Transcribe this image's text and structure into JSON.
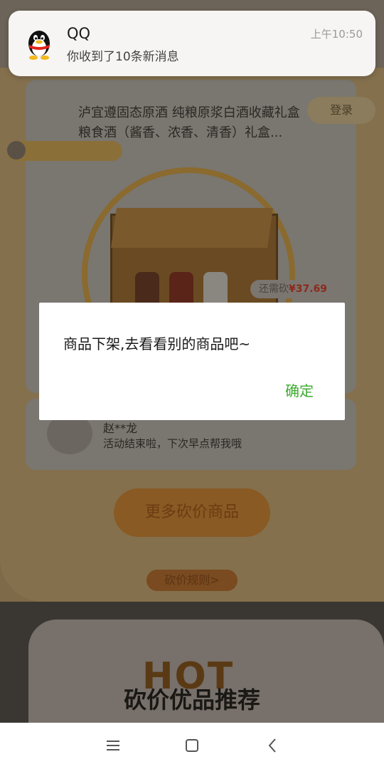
{
  "notification": {
    "app": "QQ",
    "time": "上午10:50",
    "message": "你收到了10条新消息"
  },
  "product": {
    "title": "泸宜遵固态原酒 纯粮原浆白酒收藏礼盒 粮食酒（酱香、浓香、清香）礼盒...",
    "login_label": "登录",
    "remain_label": "还需砍",
    "remain_price": "¥37.69"
  },
  "helper": {
    "name": "赵**龙",
    "message": "活动结束啦，下次早点帮我哦"
  },
  "more_button": "更多砍价商品",
  "rules_button": "砍价规则>",
  "recommend": {
    "hot": "HOT",
    "title": "砍价优品推荐"
  },
  "dialog": {
    "message": "商品下架,去看看别的商品吧~",
    "confirm": "确定"
  },
  "colors": {
    "confirm": "#3cab2e"
  },
  "icons": {
    "qq": "qq-penguin-icon",
    "nav_menu": "menu-icon",
    "nav_home": "home-square-icon",
    "nav_back": "back-chevron-icon"
  }
}
